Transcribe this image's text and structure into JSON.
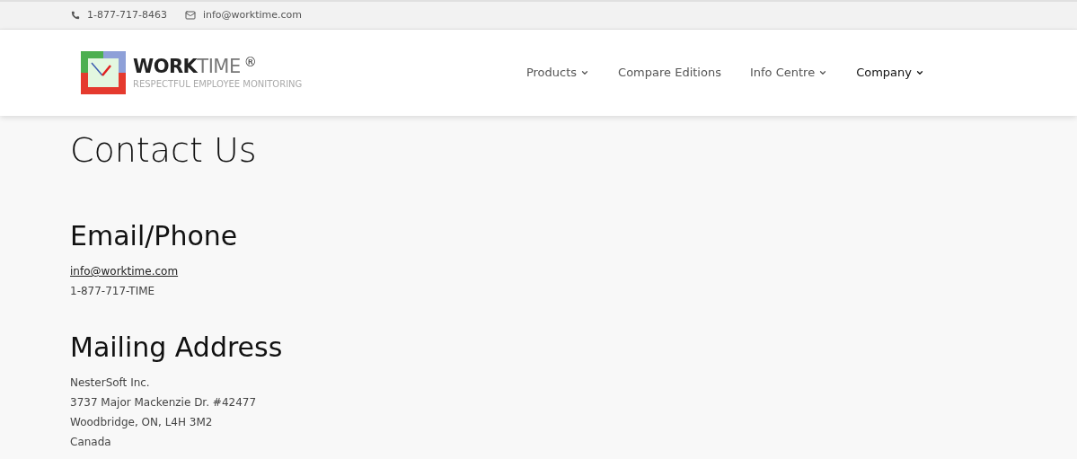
{
  "top_bar": {
    "phone": "1-877-717-8463",
    "email": "info@worktime.com"
  },
  "logo": {
    "brand_bold": "WORK",
    "brand_light": "TIME",
    "mark": "®",
    "tagline": "RESPECTFUL EMPLOYEE MONITORING"
  },
  "nav": [
    {
      "label": "Products",
      "dropdown": true,
      "selected": false
    },
    {
      "label": "Compare Editions",
      "dropdown": false,
      "selected": false
    },
    {
      "label": "Info Centre",
      "dropdown": true,
      "selected": false
    },
    {
      "label": "Company",
      "dropdown": true,
      "selected": true
    }
  ],
  "page_title": "Contact Us",
  "sections": [
    {
      "heading": "Email/Phone",
      "lines": [
        {
          "kind": "link",
          "text": "info@worktime.com"
        },
        {
          "kind": "text",
          "text": "1-877-717-TIME"
        }
      ]
    },
    {
      "heading": "Mailing Address",
      "lines": [
        {
          "kind": "text",
          "text": "NesterSoft Inc."
        },
        {
          "kind": "text",
          "text": "3737 Major Mackenzie Dr. #42477"
        },
        {
          "kind": "text",
          "text": "Woodbridge, ON, L4H 3M2"
        },
        {
          "kind": "text",
          "text": "Canada"
        }
      ]
    }
  ]
}
